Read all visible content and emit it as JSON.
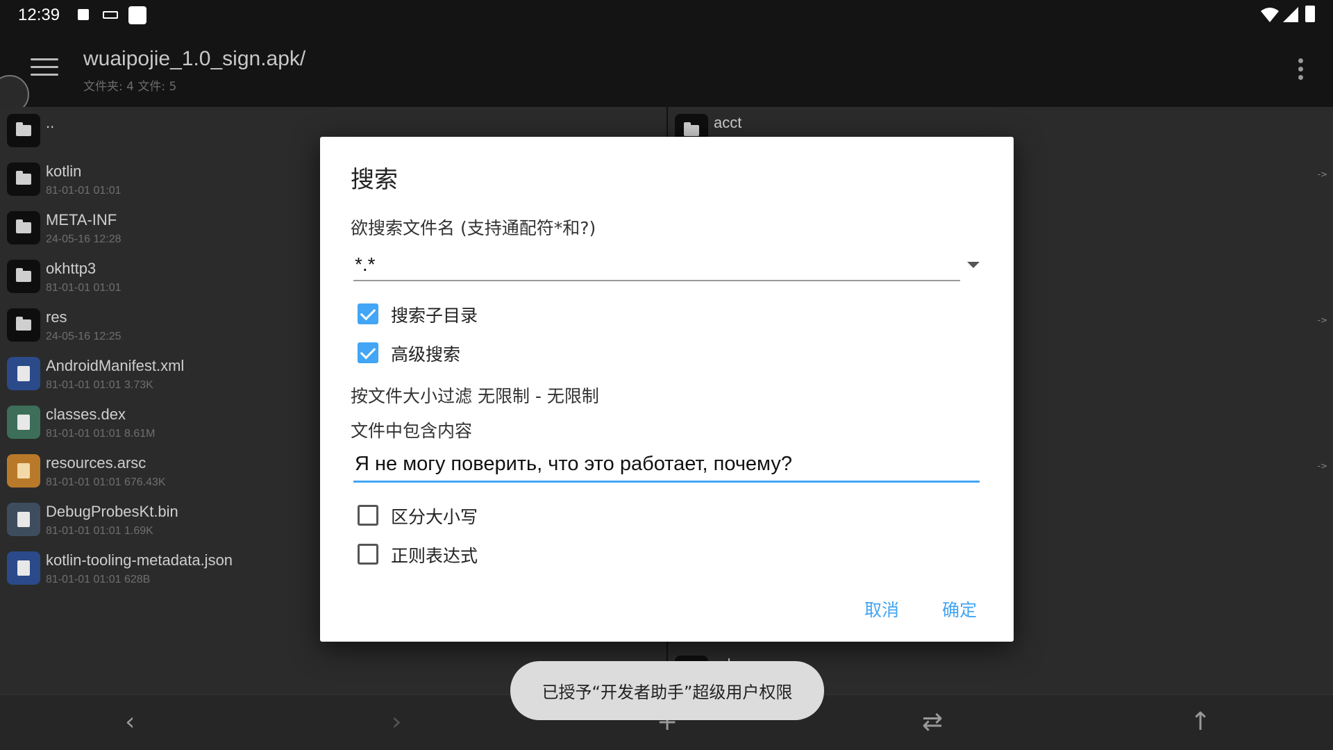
{
  "status_bar": {
    "time": "12:39"
  },
  "toolbar": {
    "title": "wuaipojie_1.0_sign.apk/",
    "subtitle": "文件夹: 4  文件: 5"
  },
  "left_pane": {
    "files": [
      {
        "name": "..",
        "meta": "",
        "icon": "folder-icon"
      },
      {
        "name": "kotlin",
        "meta": "81-01-01 01:01",
        "icon": "folder-icon"
      },
      {
        "name": "META-INF",
        "meta": "24-05-16 12:28",
        "icon": "folder-icon"
      },
      {
        "name": "okhttp3",
        "meta": "81-01-01 01:01",
        "icon": "folder-icon"
      },
      {
        "name": "res",
        "meta": "24-05-16 12:25",
        "icon": "folder-icon"
      },
      {
        "name": "AndroidManifest.xml",
        "meta": "81-01-01 01:01  3.73K",
        "icon": "xml-file-icon"
      },
      {
        "name": "classes.dex",
        "meta": "81-01-01 01:01  8.61M",
        "icon": "dex-file-icon"
      },
      {
        "name": "resources.arsc",
        "meta": "81-01-01 01:01  676.43K",
        "icon": "arsc-file-icon"
      },
      {
        "name": "DebugProbesKt.bin",
        "meta": "81-01-01 01:01  1.69K",
        "icon": "bin-file-icon"
      },
      {
        "name": "kotlin-tooling-metadata.json",
        "meta": "81-01-01 01:01  628B",
        "icon": "json-file-icon"
      }
    ]
  },
  "right_pane": {
    "files": [
      {
        "name": "acct",
        "meta": ""
      },
      {
        "name": "odm",
        "meta": ""
      }
    ],
    "arrow_hint": "->"
  },
  "dialog": {
    "title": "搜索",
    "filename_label": "欲搜索文件名 (支持通配符*和?)",
    "filename_value": "*.*",
    "search_subdirs_label": "搜索子目录",
    "search_subdirs_checked": true,
    "advanced_search_label": "高级搜索",
    "advanced_search_checked": true,
    "size_filter_label": "按文件大小过滤  无限制 - 无限制",
    "content_label": "文件中包含内容",
    "content_value": "Я не могу поверить, что это работает, почему?",
    "case_sensitive_label": "区分大小写",
    "case_sensitive_checked": false,
    "regex_label": "正则表达式",
    "regex_checked": false,
    "cancel_label": "取消",
    "ok_label": "确定",
    "accent_color": "#42a5f5"
  },
  "toast": {
    "text": "已授予“开发者助手”超级用户权限"
  },
  "bottom_bar": {
    "back_icon": "‹",
    "forward_icon": "›",
    "add_icon": "+",
    "swap_icon": "⇄",
    "up_icon": "↑"
  }
}
